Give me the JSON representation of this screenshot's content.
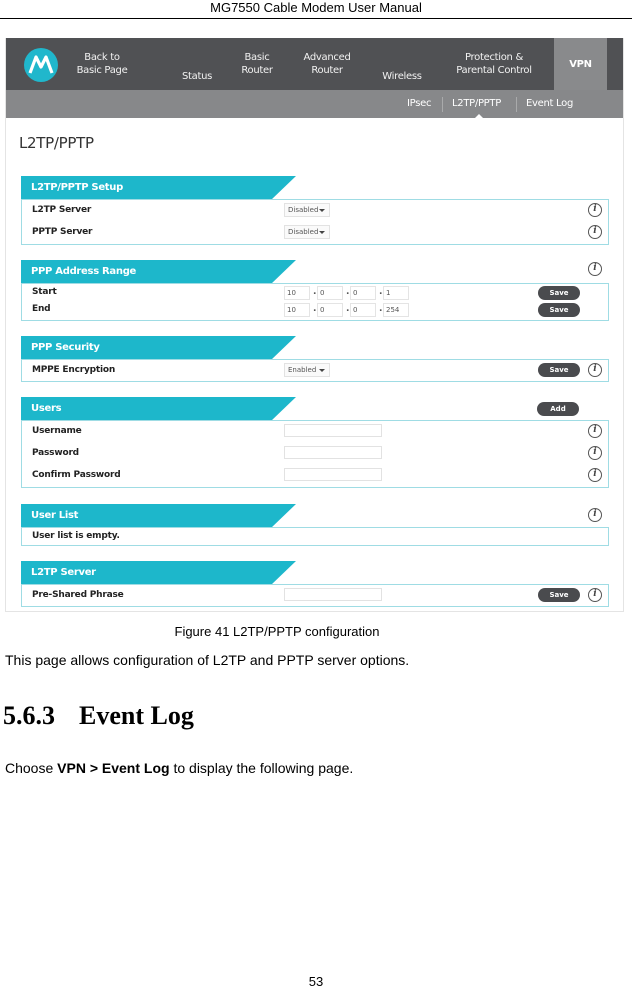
{
  "document": {
    "header": "MG7550 Cable Modem User Manual",
    "caption": "Figure 41 L2TP/PPTP configuration",
    "description": "This page allows configuration of L2TP and PPTP server options.",
    "section_number": "5.6.3",
    "section_title": "Event Log",
    "instruction": {
      "prefix": "Choose ",
      "path": "VPN > Event Log",
      "suffix": " to display the following page."
    },
    "page_number": "53"
  },
  "ui": {
    "brand_color": "#1db7cb",
    "nav": {
      "items": [
        {
          "label": "Back to\nBasic Page"
        },
        {
          "label": "Status"
        },
        {
          "label": "Basic\nRouter"
        },
        {
          "label": "Advanced\nRouter"
        },
        {
          "label": "Wireless"
        },
        {
          "label": "Protection &\nParental Control"
        },
        {
          "label": "VPN",
          "active": true
        }
      ]
    },
    "subnav": {
      "items": [
        {
          "label": "IPsec"
        },
        {
          "label": "L2TP/PPTP",
          "active": true
        },
        {
          "label": "Event Log"
        }
      ]
    },
    "page_title": "L2TP/PPTP",
    "sections": {
      "setup": {
        "title": "L2TP/PPTP Setup",
        "rows": [
          {
            "label": "L2TP Server",
            "value": "Disabled"
          },
          {
            "label": "PPTP Server",
            "value": "Disabled"
          }
        ]
      },
      "address_range": {
        "title": "PPP Address Range",
        "rows": [
          {
            "label": "Start",
            "ip": [
              "10",
              "0",
              "0",
              "1"
            ],
            "button": "Save"
          },
          {
            "label": "End",
            "ip": [
              "10",
              "0",
              "0",
              "254"
            ],
            "button": "Save"
          }
        ]
      },
      "security": {
        "title": "PPP Security",
        "rows": [
          {
            "label": "MPPE Encryption",
            "value": "Enabled",
            "button": "Save"
          }
        ]
      },
      "users": {
        "title": "Users",
        "add_button": "Add",
        "rows": [
          {
            "label": "Username",
            "value": ""
          },
          {
            "label": "Password",
            "value": ""
          },
          {
            "label": "Confirm Password",
            "value": ""
          }
        ]
      },
      "user_list": {
        "title": "User List",
        "empty_text": "User list is empty."
      },
      "l2tp_server": {
        "title": "L2TP Server",
        "rows": [
          {
            "label": "Pre-Shared Phrase",
            "value": "",
            "button": "Save"
          }
        ]
      }
    },
    "info_glyph": "i",
    "ip_separator": "."
  }
}
